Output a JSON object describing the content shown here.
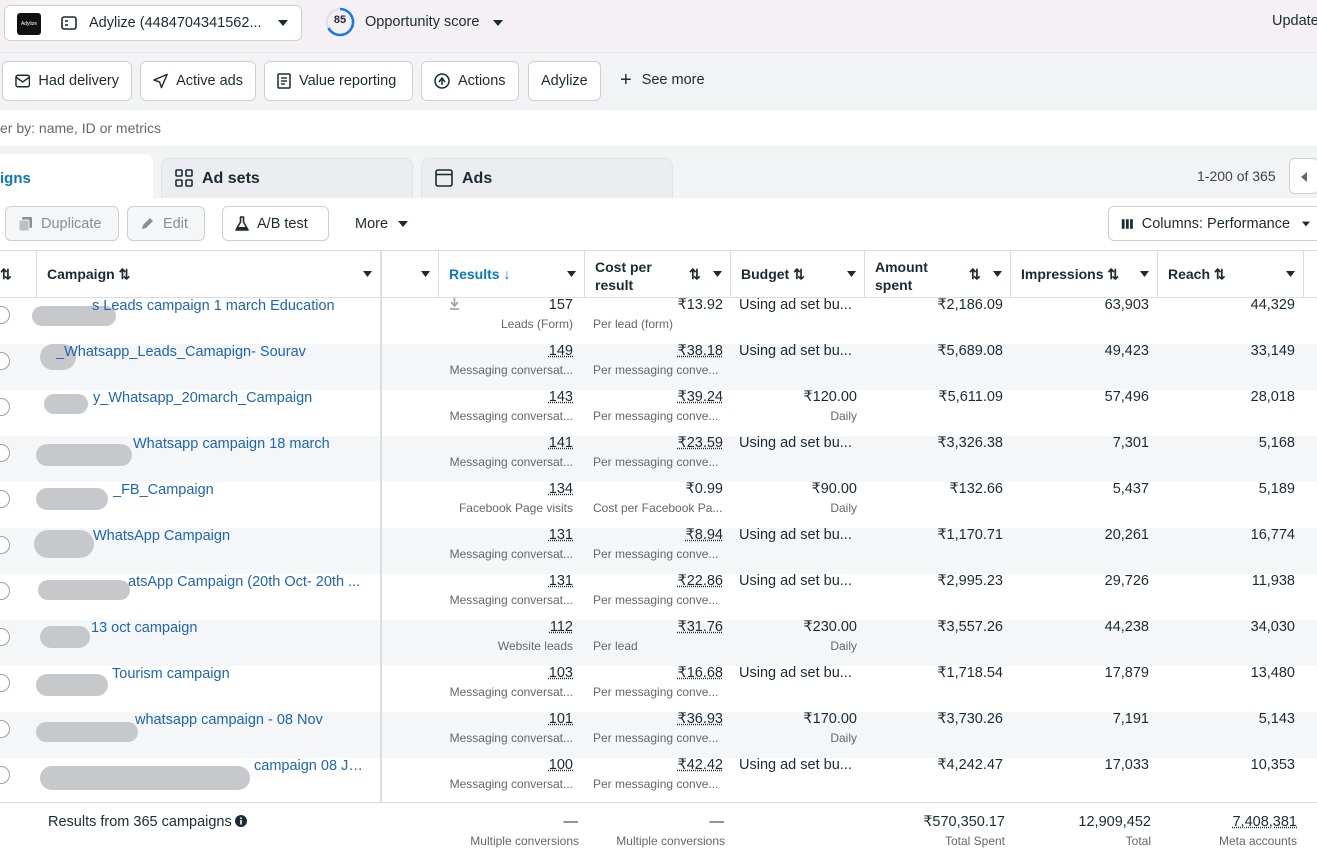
{
  "header": {
    "account_name": "Adylize (4484704341562...",
    "logo_text": "Adylize",
    "score_value": "85",
    "score_label": "Opportunity score",
    "update_label": "Update"
  },
  "filters": {
    "chips": [
      "Had delivery",
      "Active ads",
      "Value reporting",
      "Actions",
      "Adylize"
    ],
    "see_more": "See more"
  },
  "search": {
    "placeholder": "er by: name, ID or metrics"
  },
  "tabs": {
    "campaigns": "igns",
    "ad_sets": "Ad sets",
    "ads": "Ads"
  },
  "pagination": {
    "range": "1-200 of 365"
  },
  "toolbar": {
    "duplicate": "Duplicate",
    "edit": "Edit",
    "ab_test": "A/B test",
    "more": "More",
    "columns": "Columns: Performance"
  },
  "columns": {
    "campaign": "Campaign",
    "results": "Results",
    "cost_line1": "Cost per",
    "cost_line2": "result",
    "budget": "Budget",
    "amount_line1": "Amount",
    "amount_line2": "spent",
    "impressions": "Impressions",
    "reach": "Reach"
  },
  "rows": [
    {
      "name": "s Leads campaign 1 march Education",
      "results": "157",
      "results_type": "Leads (Form)",
      "cost": "₹13.92",
      "cost_type": "Per lead (form)",
      "budget": "Using ad set bu...",
      "budget_type": "",
      "spent": "₹2,186.09",
      "impressions": "63,903",
      "reach": "44,329"
    },
    {
      "name": "_Whatsapp_Leads_Camapign- Sourav",
      "results": "149",
      "results_type": "Messaging conversat...",
      "cost": "₹38.18",
      "cost_type": "Per messaging conve...",
      "budget": "Using ad set bu...",
      "budget_type": "",
      "spent": "₹5,689.08",
      "impressions": "49,423",
      "reach": "33,149"
    },
    {
      "name": "y_Whatsapp_20march_Campaign",
      "results": "143",
      "results_type": "Messaging conversat...",
      "cost": "₹39.24",
      "cost_type": "Per messaging conve...",
      "budget": "₹120.00",
      "budget_type": "Daily",
      "spent": "₹5,611.09",
      "impressions": "57,496",
      "reach": "28,018"
    },
    {
      "name": "Whatsapp campaign 18 march",
      "results": "141",
      "results_type": "Messaging conversat...",
      "cost": "₹23.59",
      "cost_type": "Per messaging conve...",
      "budget": "Using ad set bu...",
      "budget_type": "",
      "spent": "₹3,326.38",
      "impressions": "7,301",
      "reach": "5,168"
    },
    {
      "name": "_FB_Campaign",
      "results": "134",
      "results_type": "Facebook Page visits",
      "cost": "₹0.99",
      "cost_type": "Cost per Facebook Pa...",
      "budget": "₹90.00",
      "budget_type": "Daily",
      "spent": "₹132.66",
      "impressions": "5,437",
      "reach": "5,189"
    },
    {
      "name": "WhatsApp Campaign",
      "results": "131",
      "results_type": "Messaging conversat...",
      "cost": "₹8.94",
      "cost_type": "Per messaging conve...",
      "budget": "Using ad set bu...",
      "budget_type": "",
      "spent": "₹1,170.71",
      "impressions": "20,261",
      "reach": "16,774"
    },
    {
      "name": "atsApp Campaign (20th Oct- 20th ...",
      "results": "131",
      "results_type": "Messaging conversat...",
      "cost": "₹22.86",
      "cost_type": "Per messaging conve...",
      "budget": "Using ad set bu...",
      "budget_type": "",
      "spent": "₹2,995.23",
      "impressions": "29,726",
      "reach": "11,938"
    },
    {
      "name": "13 oct campaign",
      "results": "112",
      "results_type": "Website leads",
      "cost": "₹31.76",
      "cost_type": "Per lead",
      "budget": "₹230.00",
      "budget_type": "Daily",
      "spent": "₹3,557.26",
      "impressions": "44,238",
      "reach": "34,030"
    },
    {
      "name": "Tourism campaign",
      "results": "103",
      "results_type": "Messaging conversat...",
      "cost": "₹16.68",
      "cost_type": "Per messaging conve...",
      "budget": "Using ad set bu...",
      "budget_type": "",
      "spent": "₹1,718.54",
      "impressions": "17,879",
      "reach": "13,480"
    },
    {
      "name": "whatsapp campaign - 08 Nov",
      "results": "101",
      "results_type": "Messaging conversat...",
      "cost": "₹36.93",
      "cost_type": "Per messaging conve...",
      "budget": "₹170.00",
      "budget_type": "Daily",
      "spent": "₹3,730.26",
      "impressions": "7,191",
      "reach": "5,143"
    },
    {
      "name": "campaign 08 Ju...",
      "results": "100",
      "results_type": "Messaging conversat...",
      "cost": "₹42.42",
      "cost_type": "Per messaging conve...",
      "budget": "Using ad set bu...",
      "budget_type": "",
      "spent": "₹4,242.47",
      "impressions": "17,033",
      "reach": "10,353"
    }
  ],
  "footer": {
    "summary": "Results from 365 campaigns",
    "results": "—",
    "results_sub": "Multiple conversions",
    "cost": "—",
    "cost_sub": "Multiple conversions",
    "spent": "₹570,350.17",
    "spent_sub": "Total Spent",
    "impressions": "12,909,452",
    "impressions_sub": "Total",
    "reach": "7,408,381",
    "reach_sub": "Meta accounts"
  }
}
